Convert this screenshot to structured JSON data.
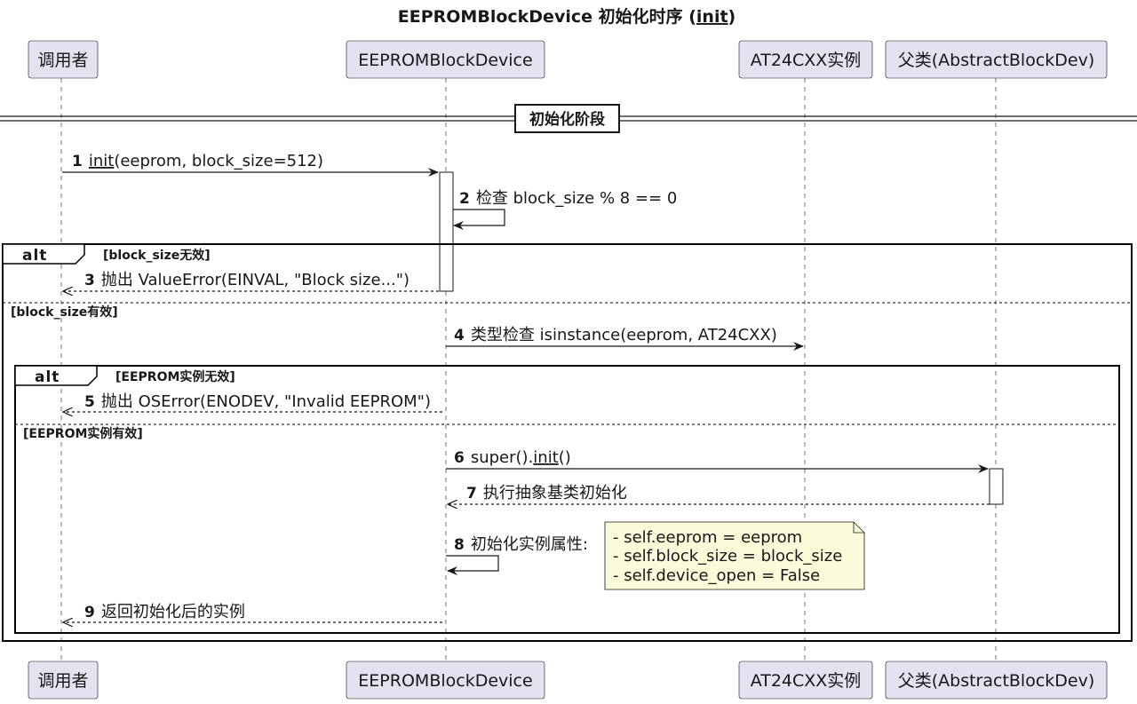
{
  "title": {
    "prefix": "EEPROMBlockDevice 初始化时序 (",
    "link": "init",
    "suffix": ")"
  },
  "participants": [
    {
      "id": "caller",
      "label": "调用者"
    },
    {
      "id": "device",
      "label": "EEPROMBlockDevice"
    },
    {
      "id": "at24",
      "label": "AT24CXX实例"
    },
    {
      "id": "parent",
      "label": "父类(AbstractBlockDev)"
    }
  ],
  "divider": {
    "label": "初始化阶段"
  },
  "messages": [
    {
      "num": "1",
      "link": "init",
      "text": "(eeprom, block_size=512)"
    },
    {
      "num": "2",
      "text": "检查 block_size % 8 == 0"
    },
    {
      "num": "3",
      "text": "抛出 ValueError(EINVAL, \"Block size...\")"
    },
    {
      "num": "4",
      "text": "类型检查 isinstance(eeprom, AT24CXX)"
    },
    {
      "num": "5",
      "text": "抛出 OSError(ENODEV, \"Invalid EEPROM\")"
    },
    {
      "num": "6",
      "prefix": "super().",
      "link": "init",
      "suffix": "()"
    },
    {
      "num": "7",
      "text": "执行抽象基类初始化"
    },
    {
      "num": "8",
      "text": "初始化实例属性:"
    },
    {
      "num": "9",
      "text": "返回初始化后的实例"
    }
  ],
  "alt_outer": {
    "keyword": "alt",
    "guard": "[block_size无效]",
    "else_guard": "[block_size有效]"
  },
  "alt_inner": {
    "keyword": "alt",
    "guard": "[EEPROM实例无效]",
    "else_guard": "[EEPROM实例有效]"
  },
  "note": {
    "lines": [
      "- self.eeprom = eeprom",
      "- self.block_size = block_size",
      "- self.device_open = False"
    ]
  },
  "colors": {
    "participant_fill": "#e2e2f0",
    "note_fill": "#fbfbd9",
    "line": "#181818"
  }
}
